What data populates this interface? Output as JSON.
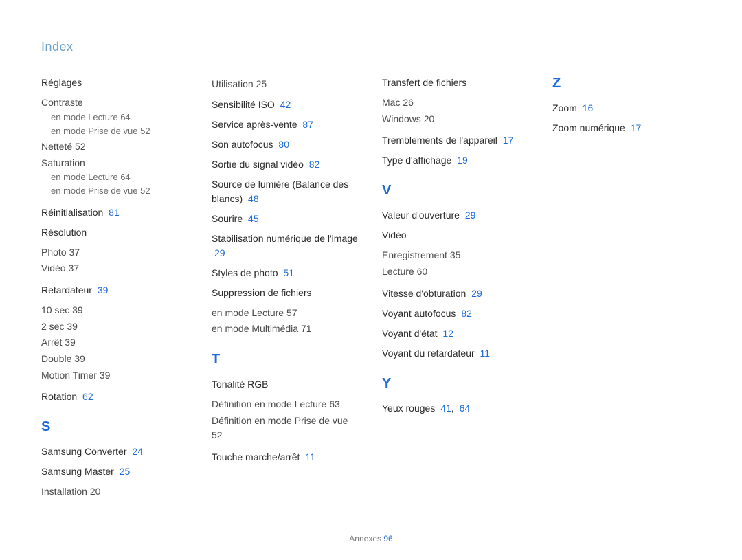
{
  "header": "Index",
  "footer": {
    "label": "Annexes",
    "page": "96"
  },
  "col1": {
    "reglages_title": "Réglages",
    "contraste": "Contraste",
    "contraste_lecture": "en mode Lecture",
    "contraste_lecture_p": "64",
    "contraste_prise": "en mode Prise de vue",
    "contraste_prise_p": "52",
    "nettete": "Netteté",
    "nettete_p": "52",
    "saturation": "Saturation",
    "sat_lecture": "en mode Lecture",
    "sat_lecture_p": "64",
    "sat_prise": "en mode Prise de vue",
    "sat_prise_p": "52",
    "reinit": "Réinitialisation",
    "reinit_p": "81",
    "resolution": "Résolution",
    "photo": "Photo",
    "photo_p": "37",
    "video": "Vidéo",
    "video_p": "37",
    "retardateur": "Retardateur",
    "retardateur_p": "39",
    "r_10s": "10 sec",
    "r_10s_p": "39",
    "r_2s": "2 sec",
    "r_2s_p": "39",
    "r_arret": "Arrêt",
    "r_arret_p": "39",
    "r_double": "Double",
    "r_double_p": "39",
    "r_mt": "Motion Timer",
    "r_mt_p": "39",
    "rotation": "Rotation",
    "rotation_p": "62",
    "letter_s": "S",
    "sconv": "Samsung Converter",
    "sconv_p": "24",
    "smaster": "Samsung Master",
    "smaster_p": "25",
    "install": "Installation",
    "install_p": "20"
  },
  "col2": {
    "util": "Utilisation",
    "util_p": "25",
    "iso": "Sensibilité ISO",
    "iso_p": "42",
    "sav": "Service après-vente",
    "sav_p": "87",
    "sonaf": "Son autofocus",
    "sonaf_p": "80",
    "sortie": "Sortie du signal vidéo",
    "sortie_p": "82",
    "source": "Source de lumière (Balance des blancs)",
    "source_p": "48",
    "sourire": "Sourire",
    "sourire_p": "45",
    "stabil": "Stabilisation numérique de l'image",
    "stabil_p": "29",
    "styles": "Styles de photo",
    "styles_p": "51",
    "suppr": "Suppression de fichiers",
    "suppr_lec": "en mode Lecture",
    "suppr_lec_p": "57",
    "suppr_mm": "en mode Multimédia",
    "suppr_mm_p": "71",
    "letter_t": "T",
    "tonalite": "Tonalité RGB",
    "ton_lec": "Définition en mode Lecture",
    "ton_lec_p": "63",
    "ton_prise": "Définition en mode Prise de vue",
    "ton_prise_p": "52",
    "touche": "Touche marche/arrêt",
    "touche_p": "11"
  },
  "col3": {
    "transfert": "Transfert de fichiers",
    "mac": "Mac",
    "mac_p": "26",
    "win": "Windows",
    "win_p": "20",
    "tremb": "Tremblements de l'appareil",
    "tremb_p": "17",
    "typeaff": "Type d'affichage",
    "typeaff_p": "19",
    "letter_v": "V",
    "valouv": "Valeur d'ouverture",
    "valouv_p": "29",
    "video": "Vidéo",
    "enreg": "Enregistrement",
    "enreg_p": "35",
    "lecture": "Lecture",
    "lecture_p": "60",
    "vitobt": "Vitesse d'obturation",
    "vitobt_p": "29",
    "voyaf": "Voyant autofocus",
    "voyaf_p": "82",
    "voyetat": "Voyant d'état",
    "voyetat_p": "12",
    "voyret": "Voyant du retardateur",
    "voyret_p": "11",
    "letter_y": "Y",
    "yeux": "Yeux rouges",
    "yeux_p1": "41",
    "yeux_sep": ",",
    "yeux_p2": "64"
  },
  "col4": {
    "letter_z": "Z",
    "zoom": "Zoom",
    "zoom_p": "16",
    "zoomnum": "Zoom numérique",
    "zoomnum_p": "17"
  }
}
